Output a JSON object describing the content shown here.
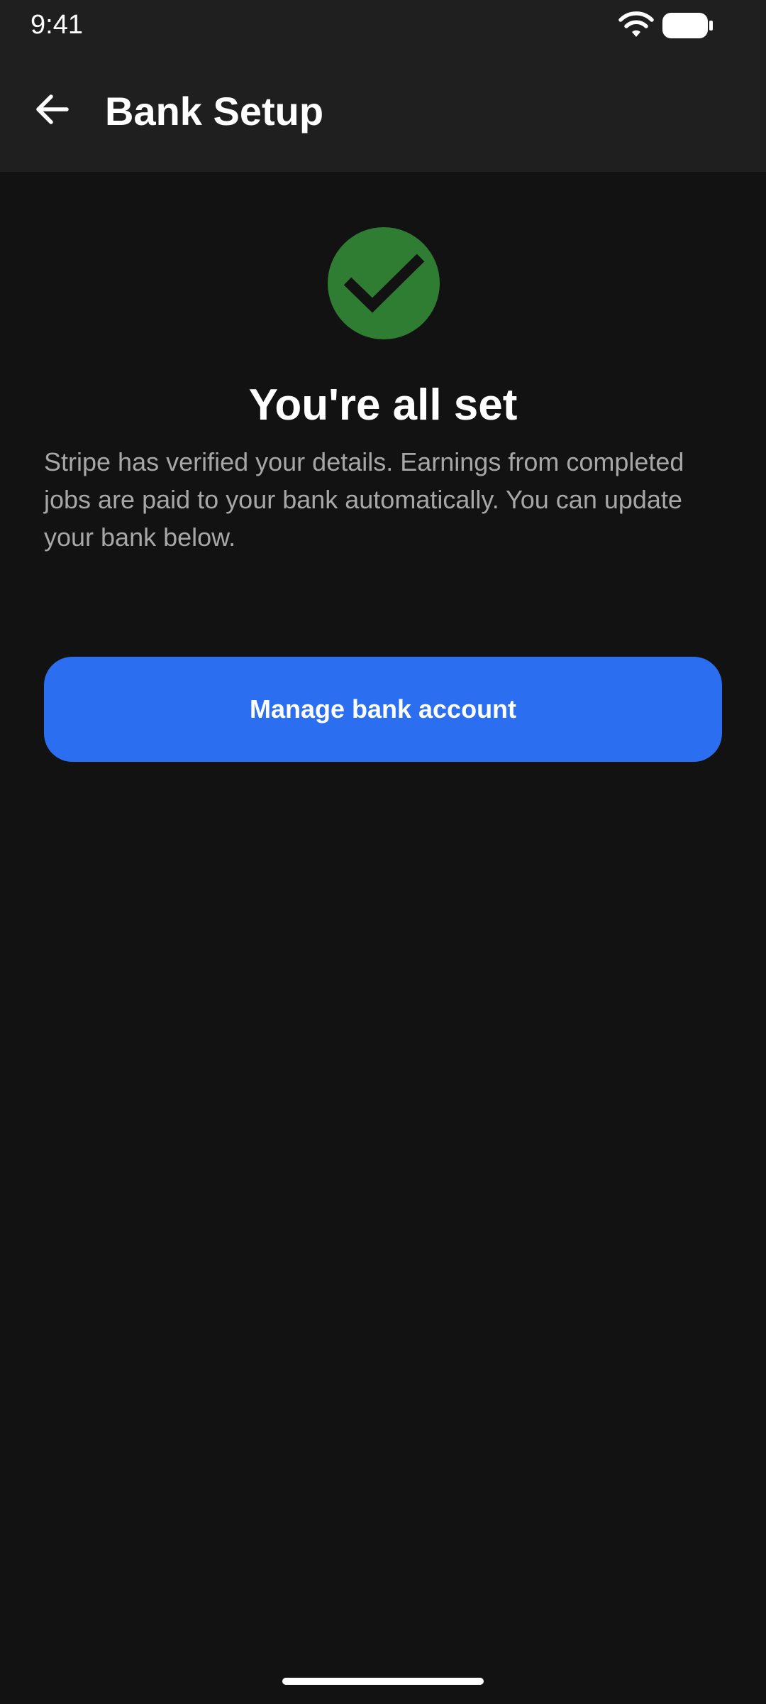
{
  "status_bar": {
    "time": "9:41",
    "wifi_icon": "wifi-icon",
    "battery_icon": "battery-icon"
  },
  "header": {
    "back_icon": "arrow-left-icon",
    "title": "Bank Setup"
  },
  "success": {
    "icon": "check-circle-icon",
    "icon_color": "#2e7d32",
    "heading": "You're all set",
    "description": "Stripe has verified your details. Earnings from completed jobs are paid to your bank automatically. You can update your bank below."
  },
  "actions": {
    "manage_label": "Manage bank account",
    "accent_color": "#2b6ff0"
  }
}
